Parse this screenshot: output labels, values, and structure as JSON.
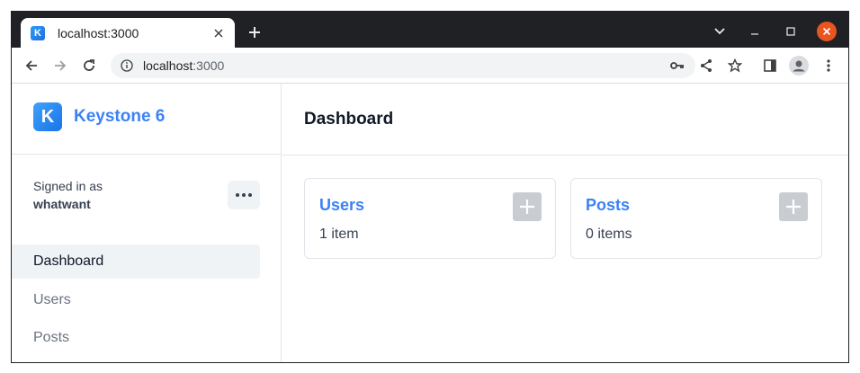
{
  "browser": {
    "tab_title": "localhost:3000",
    "url_host": "localhost",
    "url_port": ":3000"
  },
  "sidebar": {
    "brand": "Keystone 6",
    "brand_initial": "K",
    "signed_in_label": "Signed in as",
    "username": "whatwant",
    "nav": [
      {
        "label": "Dashboard",
        "active": true
      },
      {
        "label": "Users",
        "active": false
      },
      {
        "label": "Posts",
        "active": false
      }
    ]
  },
  "main": {
    "title": "Dashboard",
    "cards": [
      {
        "title": "Users",
        "count": "1 item"
      },
      {
        "title": "Posts",
        "count": "0 items"
      }
    ]
  },
  "colors": {
    "accent": "#3b82f6",
    "chrome_dark": "#202124",
    "close_button": "#e95420"
  },
  "icons": [
    "back-icon",
    "forward-icon",
    "reload-icon",
    "info-icon",
    "key-icon",
    "share-icon",
    "star-icon",
    "side-panel-icon",
    "profile-icon",
    "kebab-menu-icon",
    "plus-icon",
    "chevron-down-icon",
    "minimize-icon",
    "maximize-icon",
    "close-icon"
  ]
}
